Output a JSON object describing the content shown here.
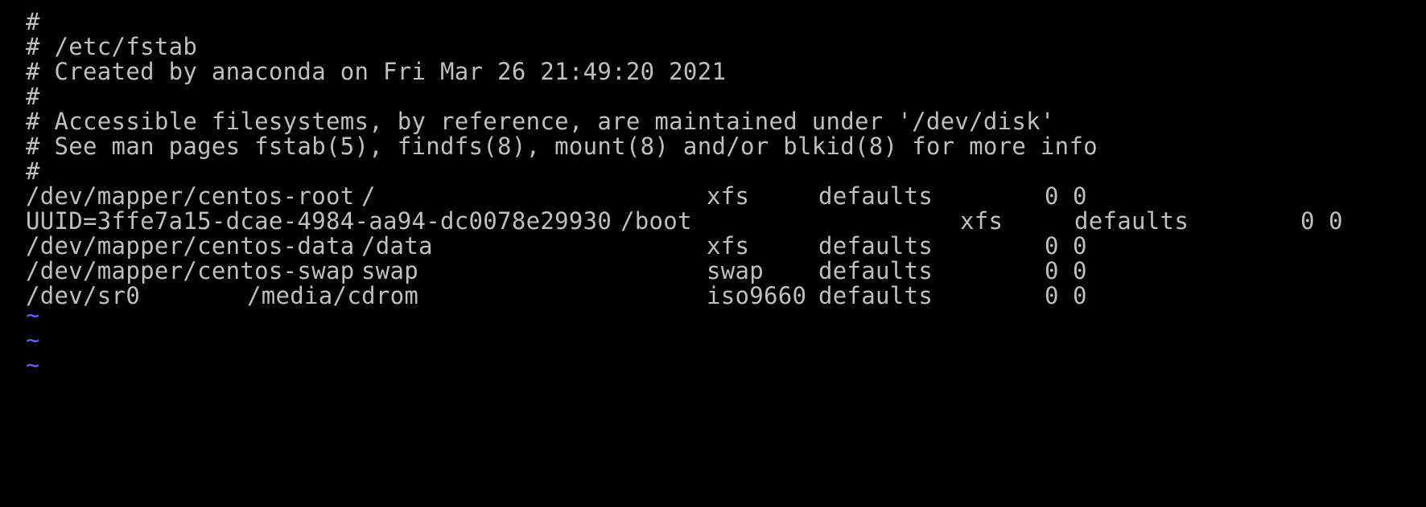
{
  "comments": [
    "#",
    "# /etc/fstab",
    "# Created by anaconda on Fri Mar 26 21:49:20 2021",
    "#",
    "# Accessible filesystems, by reference, are maintained under '/dev/disk'",
    "# See man pages fstab(5), findfs(8), mount(8) and/or blkid(8) for more info",
    "#"
  ],
  "entries": [
    {
      "device": "/dev/mapper/centos-root",
      "mount": "/",
      "fstype": "xfs",
      "options": "defaults",
      "dump": "0",
      "pass": "0"
    },
    {
      "device": "UUID=3ffe7a15-dcae-4984-aa94-dc0078e29930",
      "mount": "/boot",
      "fstype": "xfs",
      "options": "defaults",
      "dump": "0",
      "pass": "0"
    },
    {
      "device": "/dev/mapper/centos-data",
      "mount": "/data",
      "fstype": "xfs",
      "options": "defaults",
      "dump": "0",
      "pass": "0"
    },
    {
      "device": "/dev/mapper/centos-swap",
      "mount": "swap",
      "fstype": "swap",
      "options": "defaults",
      "dump": "0",
      "pass": "0"
    },
    {
      "device": "/dev/sr0",
      "mount": "/media/cdrom",
      "fstype": "iso9660",
      "options": "defaults",
      "dump": "0",
      "pass": "0"
    }
  ],
  "empty_line_markers": [
    "~",
    "~",
    "~"
  ],
  "colors": {
    "background": "#000000",
    "text": "#bfbfbf",
    "tilde": "#6a5cff"
  }
}
